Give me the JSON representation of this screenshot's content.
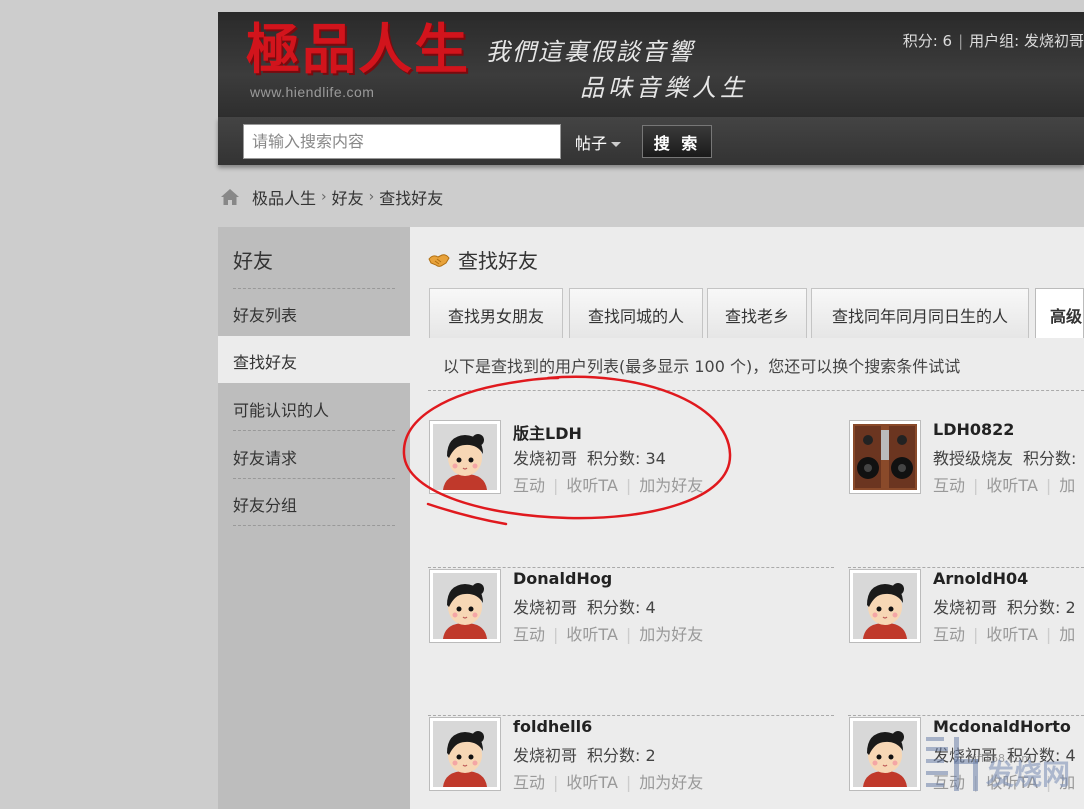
{
  "header": {
    "logo_text": "極品人生",
    "logo_url": "www.hiendlife.com",
    "slogan_line1": "我們這裏假談音響",
    "slogan_line2": "品味音樂人生",
    "points_label": "积分: 6",
    "group_label": "用户组: 发烧初哥"
  },
  "search": {
    "placeholder": "请输入搜索内容",
    "type_label": "帖子",
    "button_label": "搜 索"
  },
  "breadcrumb": {
    "items": [
      "极品人生",
      "好友",
      "查找好友"
    ],
    "separator": "›"
  },
  "sidebar": {
    "title": "好友",
    "items": [
      {
        "label": "好友列表"
      },
      {
        "label": "查找好友"
      },
      {
        "label": "可能认识的人"
      },
      {
        "label": "好友请求"
      },
      {
        "label": "好友分组"
      }
    ],
    "active_index": 1
  },
  "main": {
    "title": "查找好友",
    "tabs": [
      {
        "label": "查找男女朋友"
      },
      {
        "label": "查找同城的人"
      },
      {
        "label": "查找老乡"
      },
      {
        "label": "查找同年同月同日生的人"
      },
      {
        "label": "高级"
      }
    ],
    "notice": "以下是查找到的用户列表(最多显示 100 个)，您还可以换个搜索条件试试"
  },
  "actions": {
    "interact": "互动",
    "follow": "收听TA",
    "add_friend": "加为好友",
    "add_friend_cut": "加"
  },
  "users": [
    {
      "name": "版主LDH",
      "group": "发烧初哥",
      "points": "积分数: 34",
      "avatar": "default-avatar"
    },
    {
      "name": "LDH0822",
      "group": "教授级烧友",
      "points": "积分数:",
      "avatar": "speaker-avatar"
    },
    {
      "name": "DonaldHog",
      "group": "发烧初哥",
      "points": "积分数: 4",
      "avatar": "default-avatar"
    },
    {
      "name": "ArnoldH04",
      "group": "发烧初哥",
      "points": "积分数: 2",
      "avatar": "default-avatar"
    },
    {
      "name": "foldhell6",
      "group": "发烧初哥",
      "points": "积分数: 2",
      "avatar": "default-avatar"
    },
    {
      "name": "McdonaldHorto",
      "group": "发烧初哥",
      "points": "积分数: 4",
      "avatar": "default-avatar"
    }
  ],
  "watermark": {
    "site": "发烧网",
    "url": "hifi168.com"
  },
  "colors": {
    "brand_red": "#d2141c",
    "header_bg": "#333333",
    "annotation_red": "#e0191e"
  }
}
